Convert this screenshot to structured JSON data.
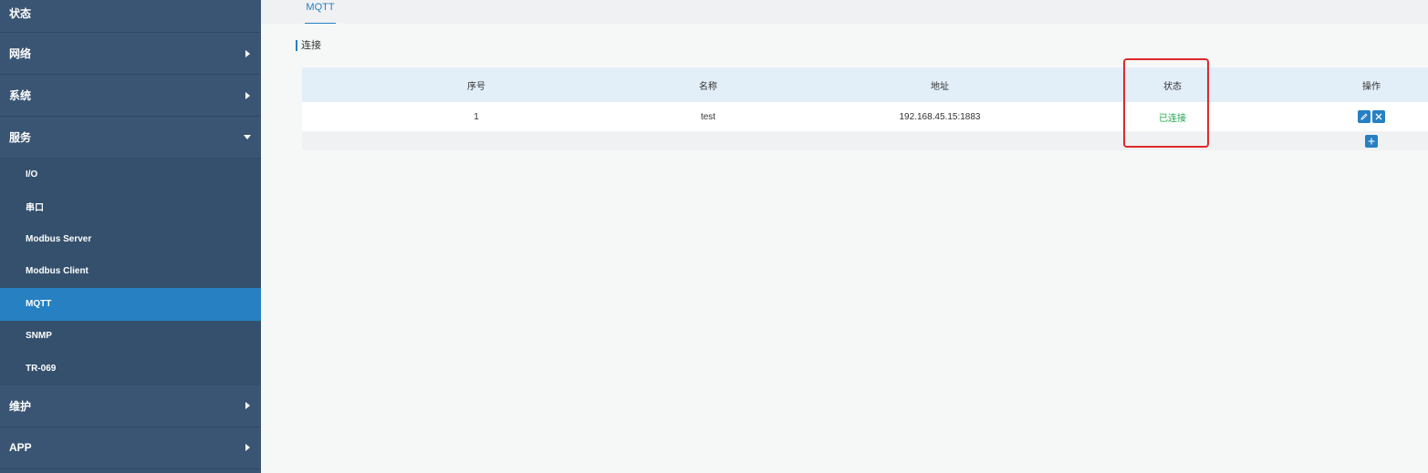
{
  "sidebar": {
    "top_item": "状态",
    "items_before": [
      {
        "label": "网络"
      },
      {
        "label": "系统"
      },
      {
        "label": "服务"
      }
    ],
    "sub_items": [
      {
        "label": "I/O"
      },
      {
        "label": "串口"
      },
      {
        "label": "Modbus Server"
      },
      {
        "label": "Modbus Client"
      },
      {
        "label": "MQTT"
      },
      {
        "label": "SNMP"
      },
      {
        "label": "TR-069"
      }
    ],
    "items_after": [
      {
        "label": "维护"
      },
      {
        "label": "APP"
      }
    ],
    "active_sub_item": "MQTT"
  },
  "tabs": [
    {
      "label": "MQTT"
    }
  ],
  "section": {
    "title": "连接"
  },
  "table": {
    "headers": [
      "序号",
      "名称",
      "地址",
      "状态",
      "操作"
    ],
    "rows": [
      {
        "index": "1",
        "name": "test",
        "address": "192.168.45.15:1883",
        "status": "已连接"
      }
    ]
  },
  "colors": {
    "sidebar_bg": "#3a5573",
    "active": "#2680c2",
    "status_connected": "#1ea74a",
    "highlight": "#e0282a"
  },
  "icons": {
    "edit": "edit-icon",
    "delete": "close-icon",
    "add": "plus-icon"
  }
}
